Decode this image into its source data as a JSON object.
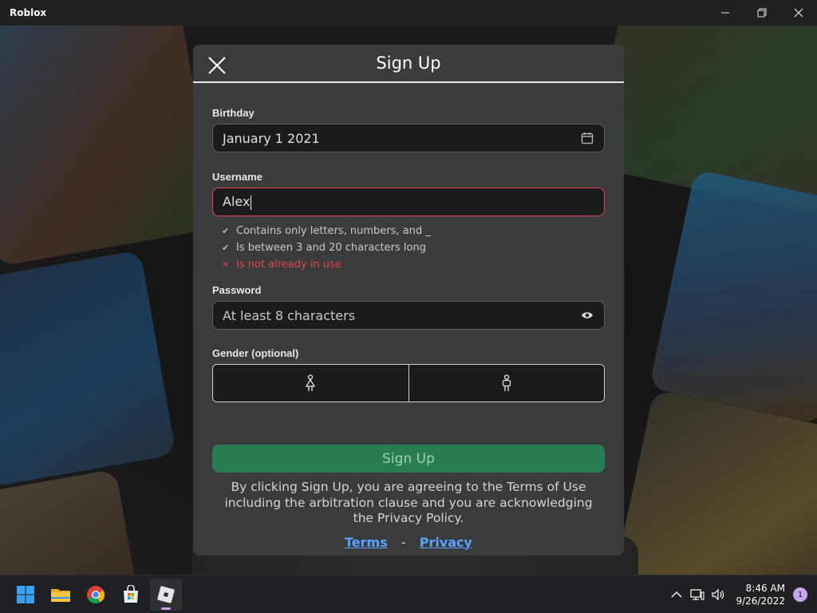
{
  "window": {
    "title": "Roblox"
  },
  "modal": {
    "title": "Sign Up",
    "birthday": {
      "label": "Birthday",
      "value": "January 1 2021"
    },
    "username": {
      "label": "Username",
      "value": "Alex",
      "rules": [
        {
          "text": "Contains only letters, numbers, and _",
          "status": "pass",
          "mark": "✔"
        },
        {
          "text": "Is between 3 and 20 characters long",
          "status": "pass",
          "mark": "✔"
        },
        {
          "text": "Is not already in use",
          "status": "fail",
          "mark": "✕"
        }
      ]
    },
    "password": {
      "label": "Password",
      "placeholder": "At least 8 characters"
    },
    "gender": {
      "label": "Gender (optional)",
      "options": [
        "female-icon",
        "male-icon"
      ]
    },
    "signup_button": "Sign Up",
    "legal_text": "By clicking Sign Up, you are agreeing to the Terms of Use including the arbitration clause and you are acknowledging the Privacy Policy.",
    "terms_link": "Terms",
    "separator": "-",
    "privacy_link": "Privacy"
  },
  "colors": {
    "signup_green": "#2a7c52",
    "error_red": "#e2454a",
    "link_blue": "#5aa2ff",
    "modal_bg": "#393b3d"
  },
  "taskbar": {
    "apps": [
      "windows-start-icon",
      "file-explorer-icon",
      "chrome-icon",
      "microsoft-store-icon",
      "roblox-icon"
    ],
    "active_app": "roblox-icon",
    "time": "8:46 AM",
    "date": "9/26/2022",
    "notification_count": "1"
  }
}
